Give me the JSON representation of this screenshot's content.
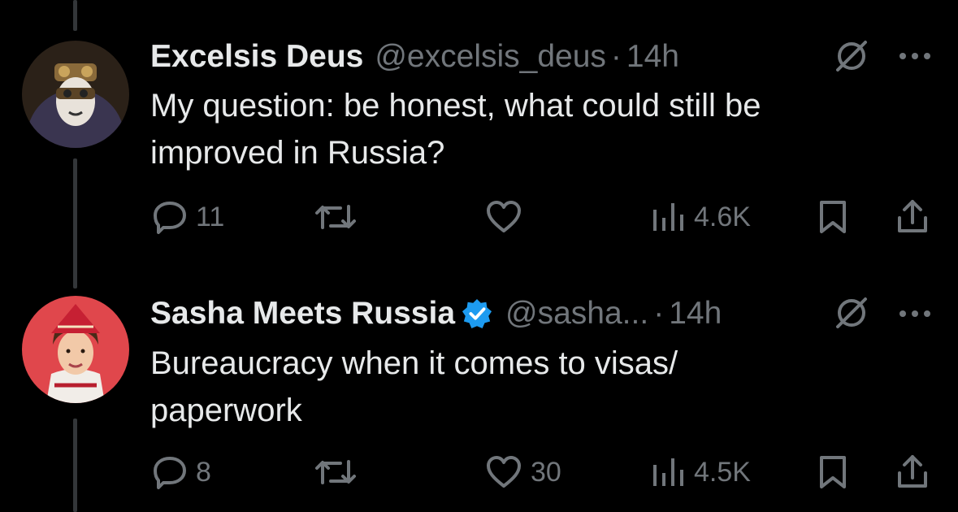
{
  "tweets": [
    {
      "name": "Excelsis Deus",
      "handle": "@excelsis_deus",
      "dot": "·",
      "time": "14h",
      "verified": false,
      "text_line1": "My question: be honest, what could still be",
      "text_line2": "improved in Russia?",
      "replies": "11",
      "reposts": "",
      "likes": "",
      "views": "4.6K"
    },
    {
      "name": "Sasha Meets Russia",
      "handle": "@sasha...",
      "dot": "·",
      "time": "14h",
      "verified": true,
      "text_line1": "Bureaucracy when it comes to visas/",
      "text_line2": "paperwork",
      "replies": "8",
      "reposts": "",
      "likes": "30",
      "views": "4.5K"
    }
  ],
  "colors": {
    "background": "#000000",
    "primary_text": "#e7e9ea",
    "secondary_text": "#71767b",
    "verified_blue": "#1d9bf0",
    "thread_line": "#333639"
  },
  "icons": [
    "reply-icon",
    "repost-icon",
    "like-icon",
    "views-icon",
    "bookmark-icon",
    "share-icon",
    "grok-icon",
    "more-icon",
    "verified-badge-icon"
  ]
}
